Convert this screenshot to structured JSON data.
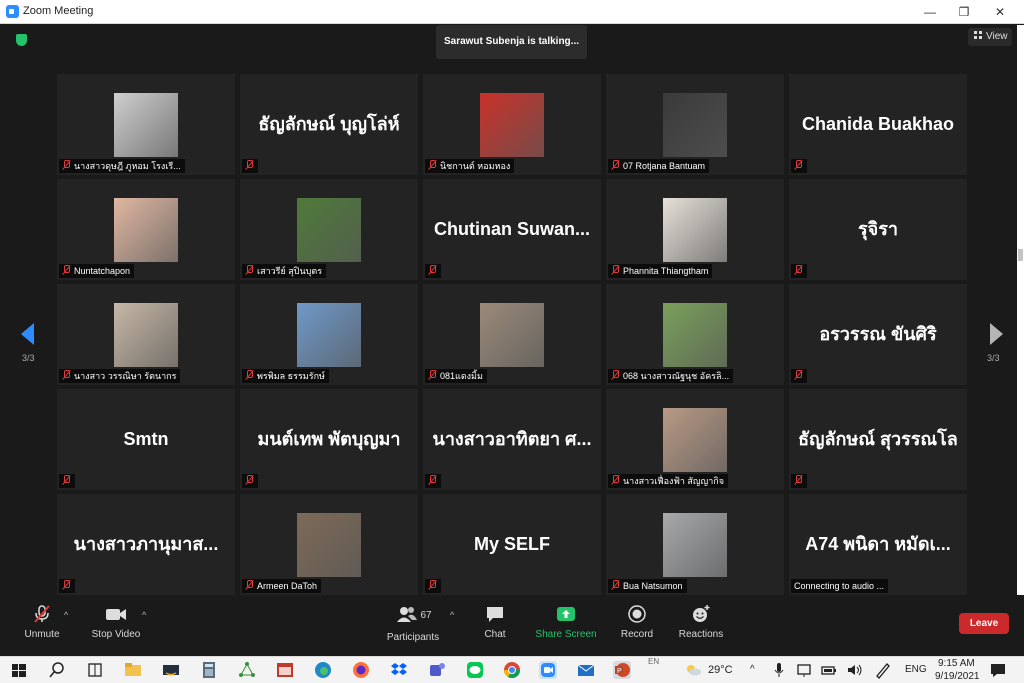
{
  "window": {
    "title": "Zoom Meeting",
    "controls": {
      "minimize": "—",
      "restore": "❐",
      "close": "✕"
    }
  },
  "meeting": {
    "talking": "Sarawut Subenja is talking...",
    "view_label": "View",
    "page_left": "3/3",
    "page_right": "3/3"
  },
  "participants": [
    {
      "name": "นางสาวดุษฎี ภูหอม  โรงเรี...",
      "video": true,
      "photo_color": "#cfcfcf"
    },
    {
      "name": "",
      "big": "ธัญลักษณ์ บุญโล่ห์",
      "video": false
    },
    {
      "name": "นิชกานต์ หอมหอง",
      "video": true,
      "photo_color": "#c9322a"
    },
    {
      "name": "07 Rotjana Bantuam",
      "video": true,
      "photo_color": "#3a3a3a"
    },
    {
      "name": "",
      "big": "Chanida Buakhao",
      "video": false
    },
    {
      "name": "Nuntatchapon",
      "video": true,
      "photo_color": "#e0b7a2"
    },
    {
      "name": "เสาวรีย์ สุปินบุตร",
      "video": true,
      "photo_color": "#4f7a3a"
    },
    {
      "name": "",
      "big": "Chutinan  Suwan...",
      "video": false
    },
    {
      "name": "Phannita Thiangtham",
      "video": true,
      "photo_color": "#e6e0d8"
    },
    {
      "name": "",
      "big": "รุจิรา",
      "video": false
    },
    {
      "name": "นางสาว วรรณิษา รัตนากร",
      "video": true,
      "photo_color": "#c7b8a6"
    },
    {
      "name": "พรพิมล ธรรมรักษ์",
      "video": true,
      "photo_color": "#6f99c9"
    },
    {
      "name": "081แดงมิ้ม",
      "video": true,
      "photo_color": "#9a8a7a"
    },
    {
      "name": "068 นางสาวณัฐนุช อัครลิ...",
      "video": true,
      "photo_color": "#7aa05a"
    },
    {
      "name": "",
      "big": "อรวรรณ ขันศิริ",
      "video": false
    },
    {
      "name": "",
      "big": "Smtn",
      "video": false
    },
    {
      "name": "",
      "big": "มนต์เทพ พัตบุญมา",
      "video": false
    },
    {
      "name": "",
      "big": "นางสาวอาทิตยา ศ...",
      "video": false
    },
    {
      "name": "นางสาวเฟื่องฟ้า สัญญากิจ",
      "video": true,
      "photo_color": "#b89a86"
    },
    {
      "name": "",
      "big": "ธัญลักษณ์ สุวรรณโล",
      "video": false
    },
    {
      "name": "",
      "big": "นางสาวภานุมาส...",
      "video": false
    },
    {
      "name": "Armeen DaToh",
      "video": true,
      "photo_color": "#7d6a58"
    },
    {
      "name": "",
      "big": "My SELF",
      "video": false
    },
    {
      "name": "Bua Natsumon",
      "video": true,
      "photo_color": "#a7a9ab"
    },
    {
      "name": "Connecting to audio ...",
      "big": "A74 พนิดา หมัดเ...",
      "video": false,
      "no_mute": true
    }
  ],
  "toolbar": {
    "unmute": "Unmute",
    "stop_video": "Stop Video",
    "participants": "Participants",
    "participants_count": "67",
    "chat": "Chat",
    "share_screen": "Share Screen",
    "record": "Record",
    "reactions": "Reactions",
    "leave": "Leave"
  },
  "taskbar": {
    "weather": "29°C",
    "language": "ENG",
    "lang_small": "EN",
    "time": "9:15 AM",
    "date": "9/19/2021"
  },
  "colors": {
    "share_green": "#23c26b",
    "leave_red": "#cc2a2a",
    "mute_red": "#e03a3a",
    "zoom_blue": "#2d8cff"
  }
}
